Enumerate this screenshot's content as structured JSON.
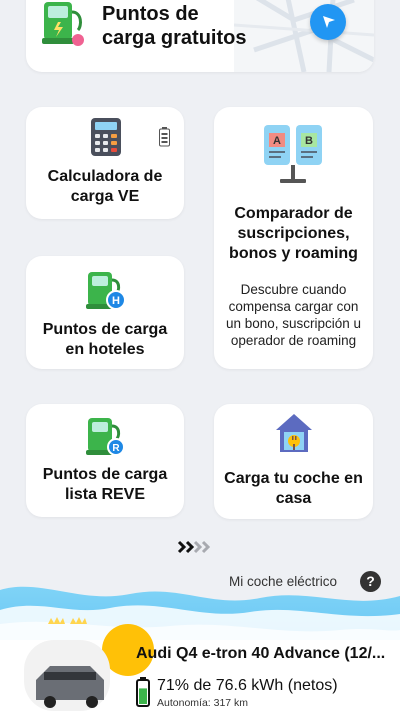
{
  "top_card": {
    "title": "Puntos de\ncarga gratuitos",
    "icon": "charging-station-icon",
    "action_icon": "navigation-arrow-icon"
  },
  "cards": {
    "calculator": {
      "title": "Calculadora de\ncarga VE",
      "icon": "calculator-icon"
    },
    "comparator": {
      "title": "Comparador de\nsuscripciones,\nbonos y roaming",
      "description": "Descubre cuando\ncompensa cargar con\nun bono, suscripción u\noperador de roaming",
      "icon": "compare-icon"
    },
    "hotels": {
      "title": "Puntos de carga\nen hoteles",
      "icon": "hotel-charging-icon"
    },
    "reve": {
      "title": "Puntos de carga\nlista REVE",
      "icon": "reve-charging-icon"
    },
    "home": {
      "title": "Carga tu coche en\ncasa",
      "icon": "home-charging-icon"
    }
  },
  "more_indicator": "chevrons-right-icon",
  "my_car": {
    "link_label": "Mi coche eléctrico",
    "help_label": "?"
  },
  "vehicle": {
    "name": "Audi Q4 e-tron 40 Advance (12/...",
    "battery": "71% de 76.6 kWh (netos)",
    "battery_level": 0.71,
    "autonomy": "Autonomía: 317 km"
  },
  "colors": {
    "accent_blue": "#2196f3",
    "station_green": "#3cb44b",
    "background": "#eef0f4"
  }
}
